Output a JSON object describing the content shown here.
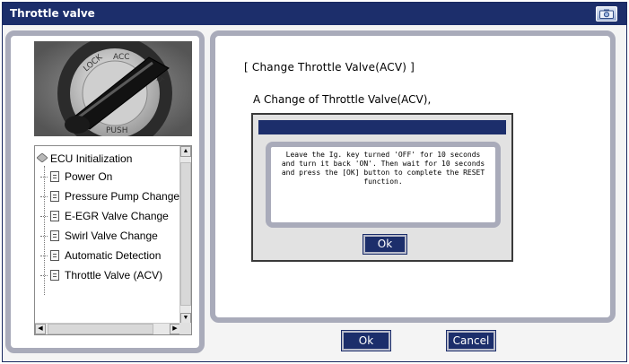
{
  "window": {
    "title": "Throttle valve",
    "camera_icon": "camera-icon"
  },
  "tree": {
    "root_label": "ECU Initialization",
    "root_icon": "diamond-icon",
    "item_icon": "document-icon",
    "items": [
      {
        "label": "Power On"
      },
      {
        "label": "Pressure Pump Change"
      },
      {
        "label": "E-EGR Valve Change"
      },
      {
        "label": "Swirl Valve Change"
      },
      {
        "label": "Automatic Detection"
      },
      {
        "label": "Throttle Valve (ACV)"
      }
    ]
  },
  "main": {
    "heading": "[ Change Throttle Valve(ACV) ]",
    "subheading": "A Change of Throttle Valve(ACV),"
  },
  "dialog": {
    "title": "",
    "message": "Leave the Ig. key turned 'OFF' for 10 seconds and turn it back 'ON'. Then wait for 10 seconds and press the [OK] button to complete the RESET function.",
    "ok_label": "Ok"
  },
  "buttons": {
    "ok_label": "Ok",
    "cancel_label": "Cancel"
  },
  "colors": {
    "title_bar": "#1c2e6b",
    "panel_border": "#a9abba",
    "button": "#1c2e6b"
  }
}
